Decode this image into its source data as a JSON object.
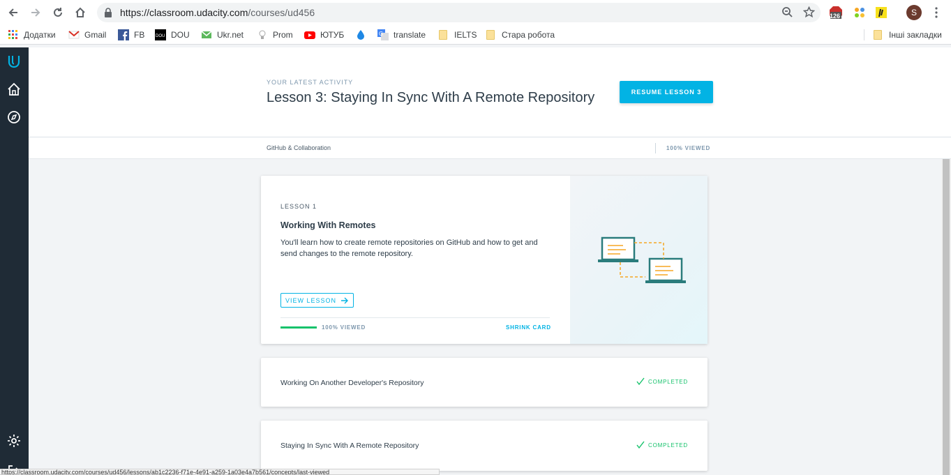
{
  "browser": {
    "url_host": "https://classroom.udacity.com",
    "url_path": "/courses/ud456",
    "profile_initial": "S",
    "ext_badge": "126"
  },
  "bookmarks": [
    {
      "label": "Додатки"
    },
    {
      "label": "Gmail"
    },
    {
      "label": "FB"
    },
    {
      "label": "DOU"
    },
    {
      "label": "Ukr.net"
    },
    {
      "label": "Prom"
    },
    {
      "label": "ЮТУБ"
    },
    {
      "label": ""
    },
    {
      "label": "translate"
    },
    {
      "label": "IELTS"
    },
    {
      "label": "Стара робота"
    },
    {
      "label": "Інші закладки"
    }
  ],
  "header": {
    "eyebrow": "YOUR LATEST ACTIVITY",
    "title": "Lesson 3: Staying In Sync With A Remote Repository",
    "resume_label": "RESUME LESSON 3"
  },
  "subbar": {
    "crumb": "GitHub & Collaboration",
    "viewed": "100% VIEWED"
  },
  "lesson1": {
    "number": "LESSON 1",
    "title": "Working With Remotes",
    "description": "You'll learn how to create remote repositories on GitHub and how to get and send changes to the remote repository.",
    "view_label": "VIEW LESSON",
    "progress": 1.0,
    "progress_label": "100% VIEWED",
    "shrink_label": "SHRINK CARD"
  },
  "lessons": [
    {
      "title": "Working On Another Developer's Repository",
      "status": "COMPLETED"
    },
    {
      "title": "Staying In Sync With A Remote Repository",
      "status": "COMPLETED"
    }
  ],
  "colors": {
    "accent": "#02b3e4",
    "success": "#15c26b",
    "rail": "#1f2b36"
  },
  "statusbar": {
    "text": "https://classroom.udacity.com/courses/ud456/lessons/ab1c2236-f71e-4e91-a259-1a03e4a7b561/concepts/last-viewed"
  }
}
